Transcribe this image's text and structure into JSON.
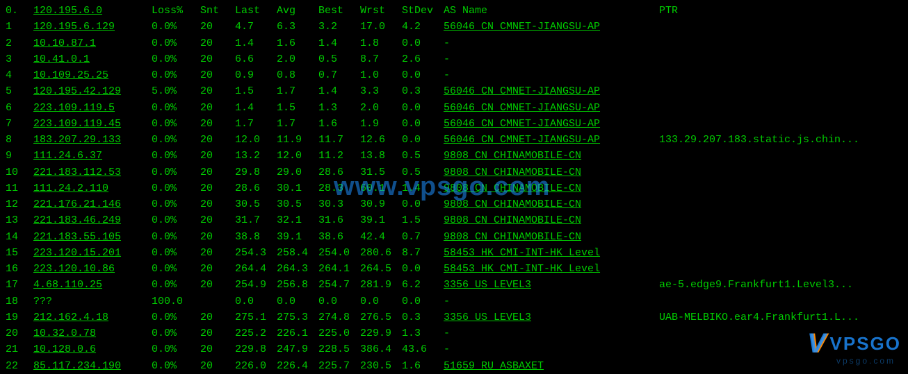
{
  "header": {
    "hop": "0.",
    "ip": "120.195.6.0",
    "loss": "Loss%",
    "snt": "Snt",
    "last": "Last",
    "avg": "Avg",
    "best": "Best",
    "wrst": "Wrst",
    "stdev": "StDev",
    "as": "AS Name",
    "ptr": "PTR"
  },
  "rows": [
    {
      "hop": "1",
      "ip": "120.195.6.129",
      "loss": "0.0%",
      "snt": "20",
      "last": "4.7",
      "avg": "6.3",
      "best": "3.2",
      "wrst": "17.0",
      "stdev": "4.2",
      "as_u": "56046 CN CMNET-JIANGSU-AP",
      "ptr": ""
    },
    {
      "hop": "2",
      "ip": "10.10.87.1",
      "loss": "0.0%",
      "snt": "20",
      "last": "1.4",
      "avg": "1.6",
      "best": "1.4",
      "wrst": "1.8",
      "stdev": "0.0",
      "as": "-",
      "ptr": ""
    },
    {
      "hop": "3",
      "ip": "10.41.0.1",
      "loss": "0.0%",
      "snt": "20",
      "last": "6.6",
      "avg": "2.0",
      "best": "0.5",
      "wrst": "8.7",
      "stdev": "2.6",
      "as": "-",
      "ptr": ""
    },
    {
      "hop": "4",
      "ip": "10.109.25.25",
      "loss": "0.0%",
      "snt": "20",
      "last": "0.9",
      "avg": "0.8",
      "best": "0.7",
      "wrst": "1.0",
      "stdev": "0.0",
      "as": "-",
      "ptr": ""
    },
    {
      "hop": "5",
      "ip": "120.195.42.129",
      "loss": "5.0%",
      "snt": "20",
      "last": "1.5",
      "avg": "1.7",
      "best": "1.4",
      "wrst": "3.3",
      "stdev": "0.3",
      "as_u": "56046 CN CMNET-JIANGSU-AP",
      "ptr": ""
    },
    {
      "hop": "6",
      "ip": "223.109.119.5",
      "loss": "0.0%",
      "snt": "20",
      "last": "1.4",
      "avg": "1.5",
      "best": "1.3",
      "wrst": "2.0",
      "stdev": "0.0",
      "as_u": "56046 CN CMNET-JIANGSU-AP",
      "ptr": ""
    },
    {
      "hop": "7",
      "ip": "223.109.119.45",
      "loss": "0.0%",
      "snt": "20",
      "last": "1.7",
      "avg": "1.7",
      "best": "1.6",
      "wrst": "1.9",
      "stdev": "0.0",
      "as_u": "56046 CN CMNET-JIANGSU-AP",
      "ptr": ""
    },
    {
      "hop": "8",
      "ip": "183.207.29.133",
      "loss": "0.0%",
      "snt": "20",
      "last": "12.0",
      "avg": "11.9",
      "best": "11.7",
      "wrst": "12.6",
      "stdev": "0.0",
      "as_u": "56046 CN CMNET-JIANGSU-AP",
      "ptr": "133.29.207.183.static.js.chin..."
    },
    {
      "hop": "9",
      "ip": "111.24.6.37",
      "loss": "0.0%",
      "snt": "20",
      "last": "13.2",
      "avg": "12.0",
      "best": "11.2",
      "wrst": "13.8",
      "stdev": "0.5",
      "as_u": "9808  CN CHINAMOBILE-CN",
      "ptr": ""
    },
    {
      "hop": "10",
      "ip": "221.183.112.53",
      "loss": "0.0%",
      "snt": "20",
      "last": "29.8",
      "avg": "29.0",
      "best": "28.6",
      "wrst": "31.5",
      "stdev": "0.5",
      "as_u": "9808  CN CHINAMOBILE-CN",
      "ptr": ""
    },
    {
      "hop": "11",
      "ip": "111.24.2.110",
      "loss": "0.0%",
      "snt": "20",
      "last": "28.6",
      "avg": "30.1",
      "best": "28.3",
      "wrst": "60.1",
      "stdev": "1.4",
      "as_u": "9808  CN CHINAMOBILE-CN",
      "ptr": ""
    },
    {
      "hop": "12",
      "ip": "221.176.21.146",
      "loss": "0.0%",
      "snt": "20",
      "last": "30.5",
      "avg": "30.5",
      "best": "30.3",
      "wrst": "30.9",
      "stdev": "0.0",
      "as_u": "9808  CN CHINAMOBILE-CN",
      "ptr": ""
    },
    {
      "hop": "13",
      "ip": "221.183.46.249",
      "loss": "0.0%",
      "snt": "20",
      "last": "31.7",
      "avg": "32.1",
      "best": "31.6",
      "wrst": "39.1",
      "stdev": "1.5",
      "as_u": "9808  CN CHINAMOBILE-CN",
      "ptr": ""
    },
    {
      "hop": "14",
      "ip": "221.183.55.105",
      "loss": "0.0%",
      "snt": "20",
      "last": "38.8",
      "avg": "39.1",
      "best": "38.6",
      "wrst": "42.4",
      "stdev": "0.7",
      "as_u": "9808  CN CHINAMOBILE-CN",
      "ptr": ""
    },
    {
      "hop": "15",
      "ip": "223.120.15.201",
      "loss": "0.0%",
      "snt": "20",
      "last": "254.3",
      "avg": "258.4",
      "best": "254.0",
      "wrst": "280.6",
      "stdev": "8.7",
      "as_u": "58453 HK CMI-INT-HK Level",
      "ptr": ""
    },
    {
      "hop": "16",
      "ip": "223.120.10.86",
      "loss": "0.0%",
      "snt": "20",
      "last": "264.4",
      "avg": "264.3",
      "best": "264.1",
      "wrst": "264.5",
      "stdev": "0.0",
      "as_u": "58453 HK CMI-INT-HK Level",
      "ptr": ""
    },
    {
      "hop": "17",
      "ip": "4.68.110.25",
      "loss": "0.0%",
      "snt": "20",
      "last": "254.9",
      "avg": "256.8",
      "best": "254.7",
      "wrst": "281.9",
      "stdev": "6.2",
      "as_u": "3356  US LEVEL3",
      "ptr": "ae-5.edge9.Frankfurt1.Level3..."
    },
    {
      "hop": "18",
      "ip": "???",
      "ip_nou": true,
      "loss": "100.0",
      "snt": "",
      "last": "0.0",
      "avg": "0.0",
      "best": "0.0",
      "wrst": "0.0",
      "stdev": "0.0",
      "as": "-",
      "ptr": ""
    },
    {
      "hop": "19",
      "ip": "212.162.4.18",
      "loss": "0.0%",
      "snt": "20",
      "last": "275.1",
      "avg": "275.3",
      "best": "274.8",
      "wrst": "276.5",
      "stdev": "0.3",
      "as_u": "3356  US LEVEL3",
      "ptr": "UAB-MELBIKO.ear4.Frankfurt1.L..."
    },
    {
      "hop": "20",
      "ip": "10.32.0.78",
      "loss": "0.0%",
      "snt": "20",
      "last": "225.2",
      "avg": "226.1",
      "best": "225.0",
      "wrst": "229.9",
      "stdev": "1.3",
      "as": "-",
      "ptr": ""
    },
    {
      "hop": "21",
      "ip": "10.128.0.6",
      "loss": "0.0%",
      "snt": "20",
      "last": "229.8",
      "avg": "247.9",
      "best": "228.5",
      "wrst": "386.4",
      "stdev": "43.6",
      "as": "-",
      "ptr": ""
    },
    {
      "hop": "22",
      "ip": "85.117.234.190",
      "loss": "0.0%",
      "snt": "20",
      "last": "226.0",
      "avg": "226.4",
      "best": "225.7",
      "wrst": "230.5",
      "stdev": "1.6",
      "as_u": "51659 RU ASBAXET",
      "ptr": ""
    }
  ],
  "watermark": {
    "text": "www.vpsgo.com",
    "brand": "VPSGO"
  }
}
